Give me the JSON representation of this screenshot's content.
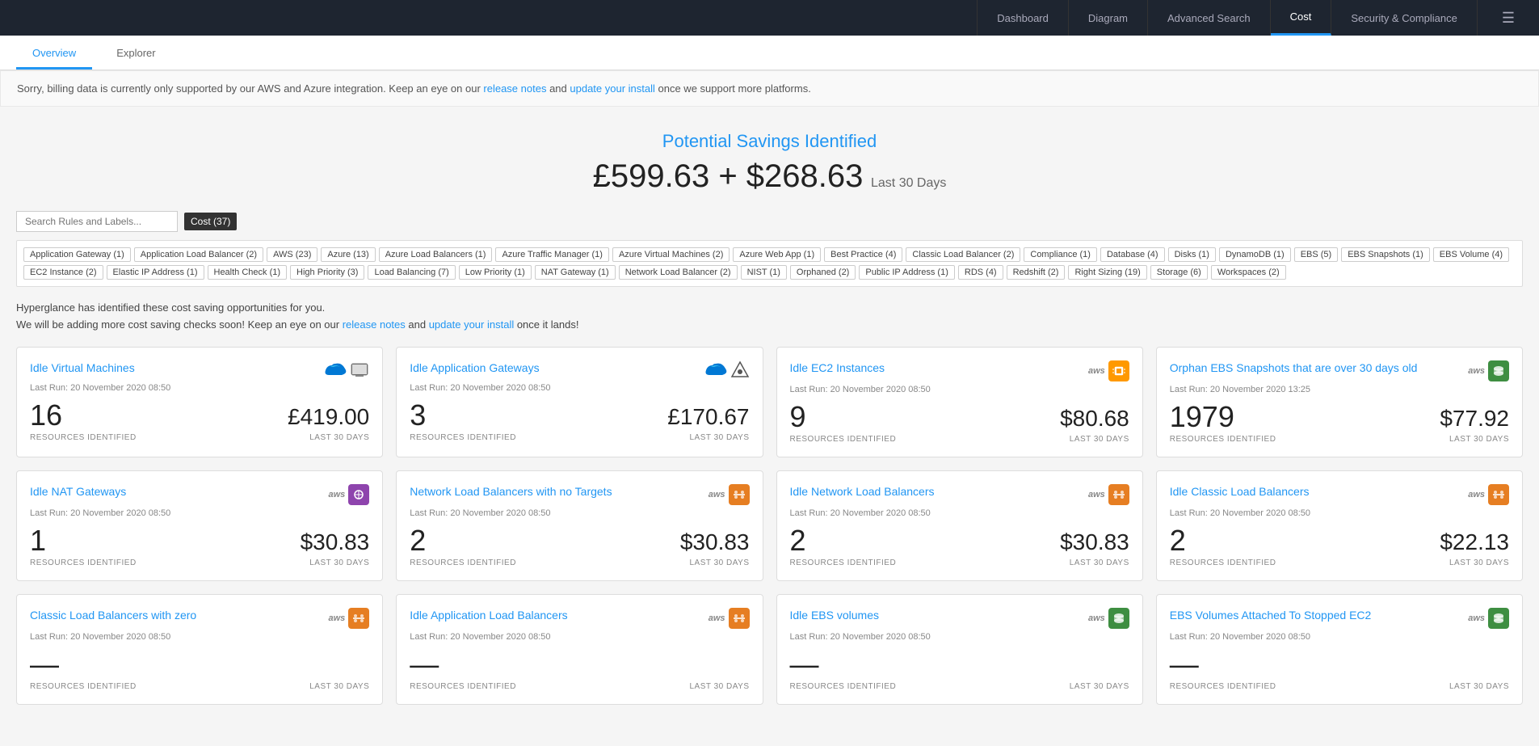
{
  "nav": {
    "links": [
      {
        "id": "dashboard",
        "label": "Dashboard",
        "active": false
      },
      {
        "id": "diagram",
        "label": "Diagram",
        "active": false
      },
      {
        "id": "advanced-search",
        "label": "Advanced Search",
        "active": false
      },
      {
        "id": "cost",
        "label": "Cost",
        "active": true
      },
      {
        "id": "security",
        "label": "Security & Compliance",
        "active": false
      }
    ],
    "menu_icon": "☰"
  },
  "tabs": [
    {
      "id": "overview",
      "label": "Overview",
      "active": true
    },
    {
      "id": "explorer",
      "label": "Explorer",
      "active": false
    }
  ],
  "info_banner": {
    "text_before": "Sorry, billing data is currently only supported by our AWS and Azure integration. Keep an eye on our ",
    "link1_text": "release notes",
    "text_between": " and ",
    "link2_text": "update your install",
    "text_after": " once we support more platforms."
  },
  "savings": {
    "title": "Potential Savings Identified",
    "amount": "£599.63 + $268.63",
    "period": "Last 30 Days"
  },
  "search": {
    "placeholder": "Search Rules and Labels...",
    "cost_badge": "Cost (37)"
  },
  "filter_tags": [
    "Application Gateway (1)",
    "Application Load Balancer (2)",
    "AWS (23)",
    "Azure (13)",
    "Azure Load Balancers (1)",
    "Azure Traffic Manager (1)",
    "Azure Virtual Machines (2)",
    "Azure Web App (1)",
    "Best Practice (4)",
    "Classic Load Balancer (2)",
    "Compliance (1)",
    "Database (4)",
    "Disks (1)",
    "DynamoDB (1)",
    "EBS (5)",
    "EBS Snapshots (1)",
    "EBS Volume (4)",
    "EC2 Instance (2)",
    "Elastic IP Address (1)",
    "Health Check (1)",
    "High Priority (3)",
    "Load Balancing (7)",
    "Low Priority (1)",
    "NAT Gateway (1)",
    "Network Load Balancer (2)",
    "NIST (1)",
    "Orphaned (2)",
    "Public IP Address (1)",
    "RDS (4)",
    "Redshift (2)",
    "Right Sizing (19)",
    "Storage (6)",
    "Workspaces (2)"
  ],
  "description": {
    "line1": "Hyperglance has identified these cost saving opportunities for you.",
    "line2_before": "We will be adding more cost saving checks soon! Keep an eye on our ",
    "link1": "release notes",
    "line2_between": " and ",
    "link2": "update your install",
    "line2_after": " once it lands!"
  },
  "cards": [
    {
      "id": "idle-vms",
      "title": "Idle Virtual Machines",
      "last_run": "Last Run: 20 November 2020 08:50",
      "count": "16",
      "amount": "£419.00",
      "label_left": "RESOURCES IDENTIFIED",
      "label_right": "LAST 30 DAYS",
      "provider": "azure",
      "icon_type": "vm"
    },
    {
      "id": "idle-app-gateways",
      "title": "Idle Application Gateways",
      "last_run": "Last Run: 20 November 2020 08:50",
      "count": "3",
      "amount": "£170.67",
      "label_left": "RESOURCES IDENTIFIED",
      "label_right": "LAST 30 DAYS",
      "provider": "azure",
      "icon_type": "gateway"
    },
    {
      "id": "idle-ec2",
      "title": "Idle EC2 Instances",
      "last_run": "Last Run: 20 November 2020 08:50",
      "count": "9",
      "amount": "$80.68",
      "label_left": "RESOURCES IDENTIFIED",
      "label_right": "LAST 30 DAYS",
      "provider": "aws",
      "icon_type": "chip"
    },
    {
      "id": "orphan-ebs",
      "title": "Orphan EBS Snapshots that are over 30 days old",
      "last_run": "Last Run: 20 November 2020 13:25",
      "count": "1979",
      "amount": "$77.92",
      "label_left": "RESOURCES IDENTIFIED",
      "label_right": "LAST 30 DAYS",
      "provider": "aws",
      "icon_type": "storage"
    },
    {
      "id": "idle-nat",
      "title": "Idle NAT Gateways",
      "last_run": "Last Run: 20 November 2020 08:50",
      "count": "1",
      "amount": "$30.83",
      "label_left": "RESOURCES IDENTIFIED",
      "label_right": "LAST 30 DAYS",
      "provider": "aws",
      "icon_type": "network"
    },
    {
      "id": "nlb-no-targets",
      "title": "Network Load Balancers with no Targets",
      "last_run": "Last Run: 20 November 2020 08:50",
      "count": "2",
      "amount": "$30.83",
      "label_left": "RESOURCES IDENTIFIED",
      "label_right": "LAST 30 DAYS",
      "provider": "aws",
      "icon_type": "nlb"
    },
    {
      "id": "idle-nlb",
      "title": "Idle Network Load Balancers",
      "last_run": "Last Run: 20 November 2020 08:50",
      "count": "2",
      "amount": "$30.83",
      "label_left": "RESOURCES IDENTIFIED",
      "label_right": "LAST 30 DAYS",
      "provider": "aws",
      "icon_type": "nlb"
    },
    {
      "id": "idle-clb",
      "title": "Idle Classic Load Balancers",
      "last_run": "Last Run: 20 November 2020 08:50",
      "count": "2",
      "amount": "$22.13",
      "label_left": "RESOURCES IDENTIFIED",
      "label_right": "LAST 30 DAYS",
      "provider": "aws",
      "icon_type": "clb"
    },
    {
      "id": "clb-zero",
      "title": "Classic Load Balancers with zero",
      "last_run": "Last Run: 20 November 2020 08:50",
      "count": "—",
      "amount": "",
      "label_left": "RESOURCES IDENTIFIED",
      "label_right": "LAST 30 DAYS",
      "provider": "aws",
      "icon_type": "clb"
    },
    {
      "id": "idle-alb",
      "title": "Idle Application Load Balancers",
      "last_run": "Last Run: 20 November 2020 08:50",
      "count": "—",
      "amount": "",
      "label_left": "RESOURCES IDENTIFIED",
      "label_right": "LAST 30 DAYS",
      "provider": "aws",
      "icon_type": "nlb"
    },
    {
      "id": "idle-ebs",
      "title": "Idle EBS volumes",
      "last_run": "Last Run: 20 November 2020 08:50",
      "count": "—",
      "amount": "",
      "label_left": "RESOURCES IDENTIFIED",
      "label_right": "LAST 30 DAYS",
      "provider": "aws",
      "icon_type": "storage"
    },
    {
      "id": "ebs-stopped",
      "title": "EBS Volumes Attached To Stopped EC2",
      "last_run": "Last Run: 20 November 2020 08:50",
      "count": "—",
      "amount": "",
      "label_left": "RESOURCES IDENTIFIED",
      "label_right": "LAST 30 DAYS",
      "provider": "aws",
      "icon_type": "storage"
    }
  ]
}
